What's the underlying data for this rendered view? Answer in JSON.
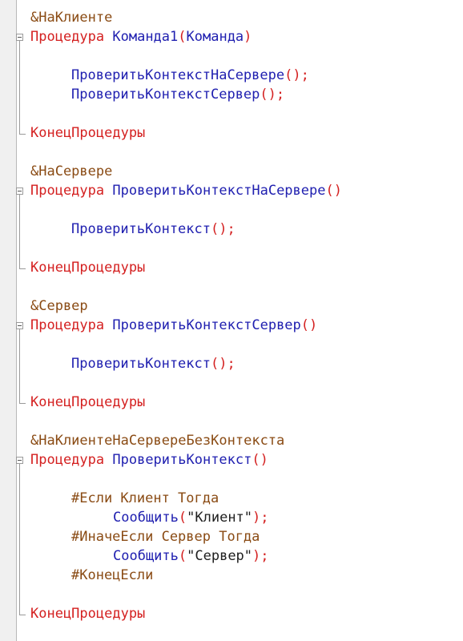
{
  "blocks": [
    {
      "directive": "&НаКлиенте",
      "proc_keyword": "Процедура",
      "proc_name": "Команда1",
      "open_paren": "(",
      "param": "Команда",
      "close_paren": ")",
      "body": [
        {
          "call": "ПроверитьКонтекстНаСервере",
          "punct": "();"
        },
        {
          "call": "ПроверитьКонтекстСервер",
          "punct": "();"
        }
      ],
      "end_keyword": "КонецПроцедуры"
    },
    {
      "directive": "&НаСервере",
      "proc_keyword": "Процедура",
      "proc_name": "ПроверитьКонтекстНаСервере",
      "parens": "()",
      "body": [
        {
          "call": "ПроверитьКонтекст",
          "punct": "();"
        }
      ],
      "end_keyword": "КонецПроцедуры"
    },
    {
      "directive": "&Сервер",
      "proc_keyword": "Процедура",
      "proc_name": "ПроверитьКонтекстСервер",
      "parens": "()",
      "body": [
        {
          "call": "ПроверитьКонтекст",
          "punct": "();"
        }
      ],
      "end_keyword": "КонецПроцедуры"
    },
    {
      "directive": "&НаКлиентеНаСервереБезКонтекста",
      "proc_keyword": "Процедура",
      "proc_name": "ПроверитьКонтекст",
      "parens": "()",
      "body": [
        {
          "preproc": "#Если Клиент Тогда"
        },
        {
          "call": "Сообщить",
          "open": "(",
          "string": "\"Клиент\"",
          "close": ");"
        },
        {
          "preproc": "#ИначеЕсли Сервер Тогда"
        },
        {
          "call": "Сообщить",
          "open": "(",
          "string": "\"Сервер\"",
          "close": ");"
        },
        {
          "preproc": "#КонецЕсли"
        }
      ],
      "end_keyword": "КонецПроцедуры"
    }
  ],
  "colors": {
    "directive": "#8a4b14",
    "keyword": "#d42020",
    "identifier": "#2020b0",
    "string": "#202020",
    "background": "#ffffff",
    "gutter": "#f0f0f0"
  }
}
